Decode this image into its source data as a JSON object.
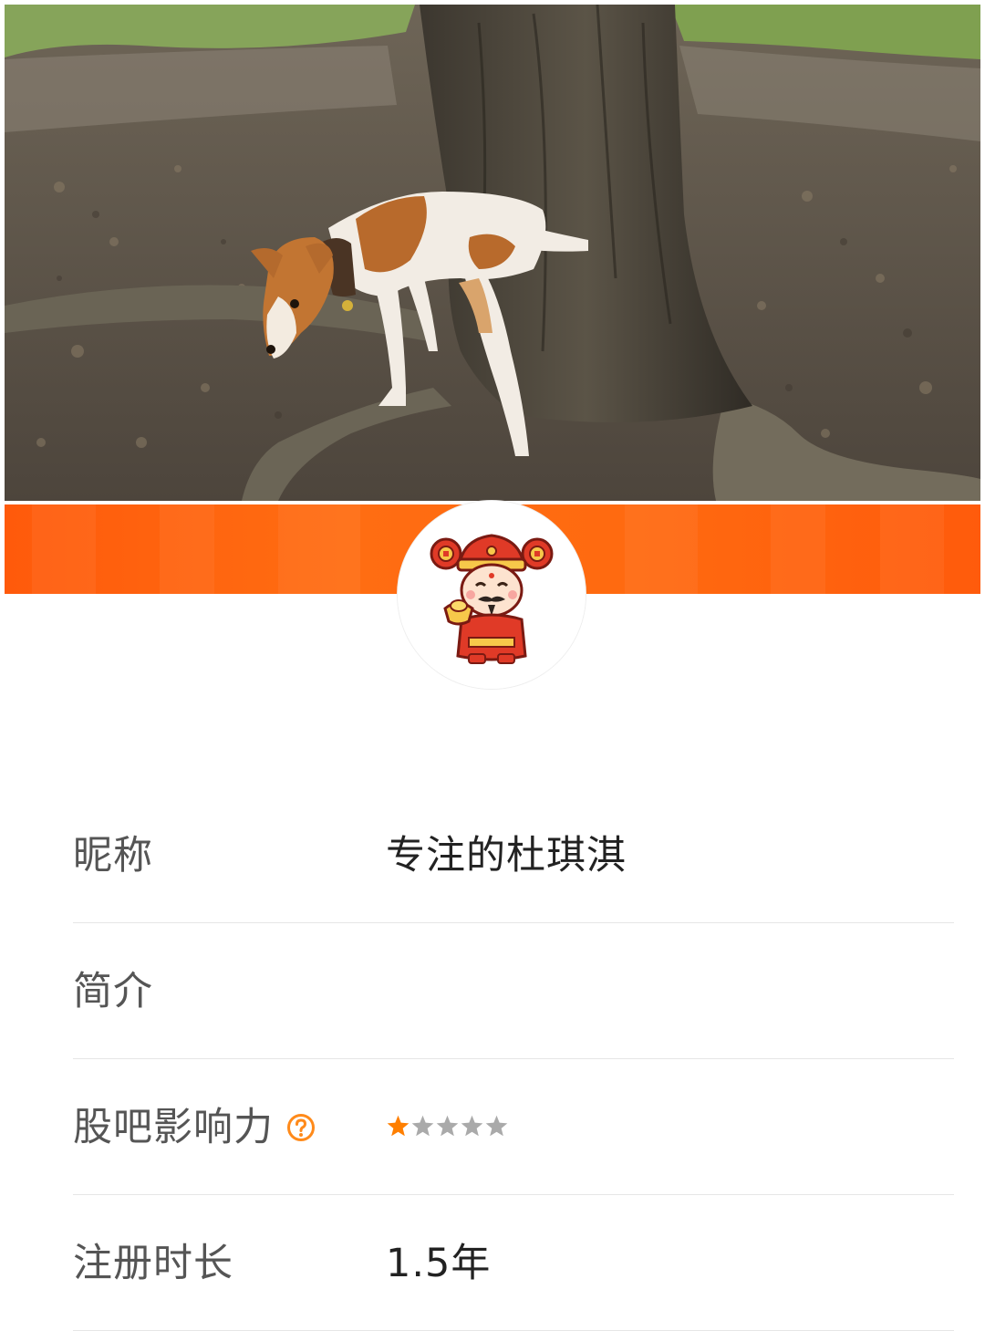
{
  "cover": {
    "icon": "cover-photo"
  },
  "avatar": {
    "icon": "caishen-avatar"
  },
  "profile": {
    "nickname_label": "昵称",
    "nickname_value": "专注的杜琪淇",
    "bio_label": "简介",
    "bio_value": "",
    "influence_label": "股吧影响力",
    "influence_help_icon": "question-circle-icon",
    "influence_stars_filled": 1,
    "influence_stars_total": 5,
    "registration_label": "注册时长",
    "registration_value": "1.5年"
  },
  "colors": {
    "banner": "#ff620e",
    "star_filled": "#ff7f00",
    "star_empty": "#aaaaaa",
    "help_icon": "#ff8a1a"
  }
}
